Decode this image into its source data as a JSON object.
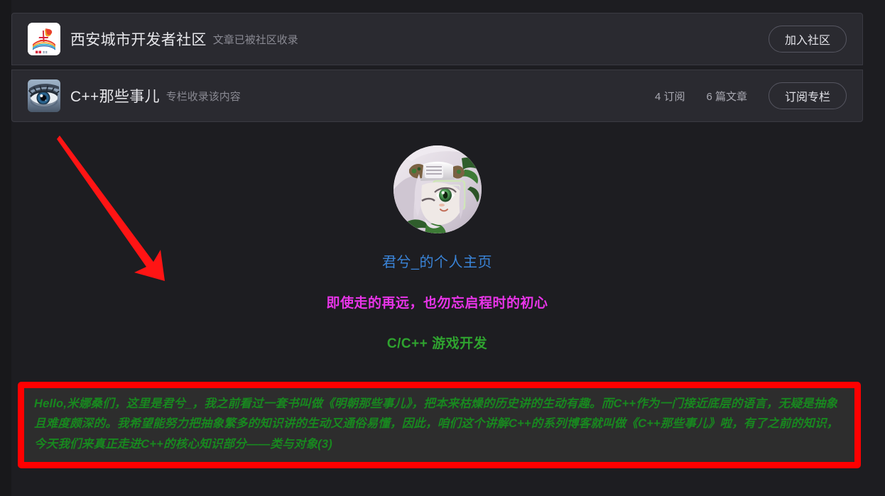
{
  "community_card": {
    "logo_icon": "xian-developer-community-logo",
    "title": "西安城市开发者社区",
    "subtitle": "文章已被社区收录",
    "join_button": "加入社区"
  },
  "column_card": {
    "avatar_icon": "eye-avatar",
    "title": "C++那些事儿",
    "subtitle": "专栏收录该内容",
    "subscribers": "4 订阅",
    "articles": "6 篇文章",
    "subscribe_button": "订阅专栏"
  },
  "article": {
    "avatar_icon": "anime-character-avatar",
    "profile_link": "君兮_的个人主页",
    "slogan": "即使走的再远，也勿忘启程时的初心",
    "tagline": "C/C++ 游戏开发",
    "highlight_text": "Hello,米娜桑们，这里是君兮_，我之前看过一套书叫做《明朝那些事儿》，把本来枯燥的历史讲的生动有趣。而C++作为一门接近底层的语言，无疑是抽象且难度颇深的。我希望能努力把抽象繁多的知识讲的生动又通俗易懂，因此，咱们这个讲解C++的系列博客就叫做《C++那些事儿》啦，有了之前的知识，今天我们来真正走进C++的核心知识部分——类与对象(3)"
  },
  "annotation": {
    "arrow_icon": "red-pointer-arrow",
    "arrow_color": "#ff1414"
  },
  "colors": {
    "page_background": "#1d1d21",
    "card_background": "#2a2a30",
    "link_blue": "#3a84d8",
    "slogan_magenta": "#e834e8",
    "tagline_green": "#2fa32f",
    "highlight_green": "#18881f",
    "highlight_border_red": "#ff0000"
  }
}
